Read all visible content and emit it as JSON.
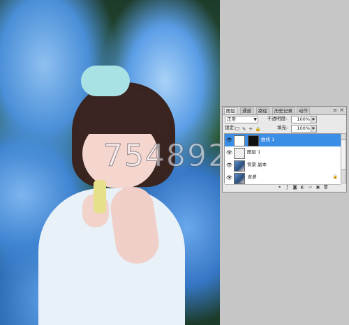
{
  "watermark": {
    "text": "754892"
  },
  "layers_panel": {
    "tabs": [
      "图层",
      "通道",
      "路径",
      "历史记录",
      "动作"
    ],
    "close_glyph": "×",
    "menu_glyph": "≡",
    "blend_mode": "正常",
    "opacity_label": "不透明度:",
    "opacity_value": "100%",
    "lock_label": "锁定:",
    "fill_label": "填充:",
    "fill_value": "100%",
    "layers": [
      {
        "name": "曲线 1",
        "selected": true
      },
      {
        "name": "图层 1",
        "selected": false
      },
      {
        "name": "背景 副本",
        "selected": false
      },
      {
        "name": "背景",
        "selected": false
      }
    ],
    "colors": {
      "selection": "#3b8ee6",
      "panel_bg": "#e9e9e9"
    }
  }
}
